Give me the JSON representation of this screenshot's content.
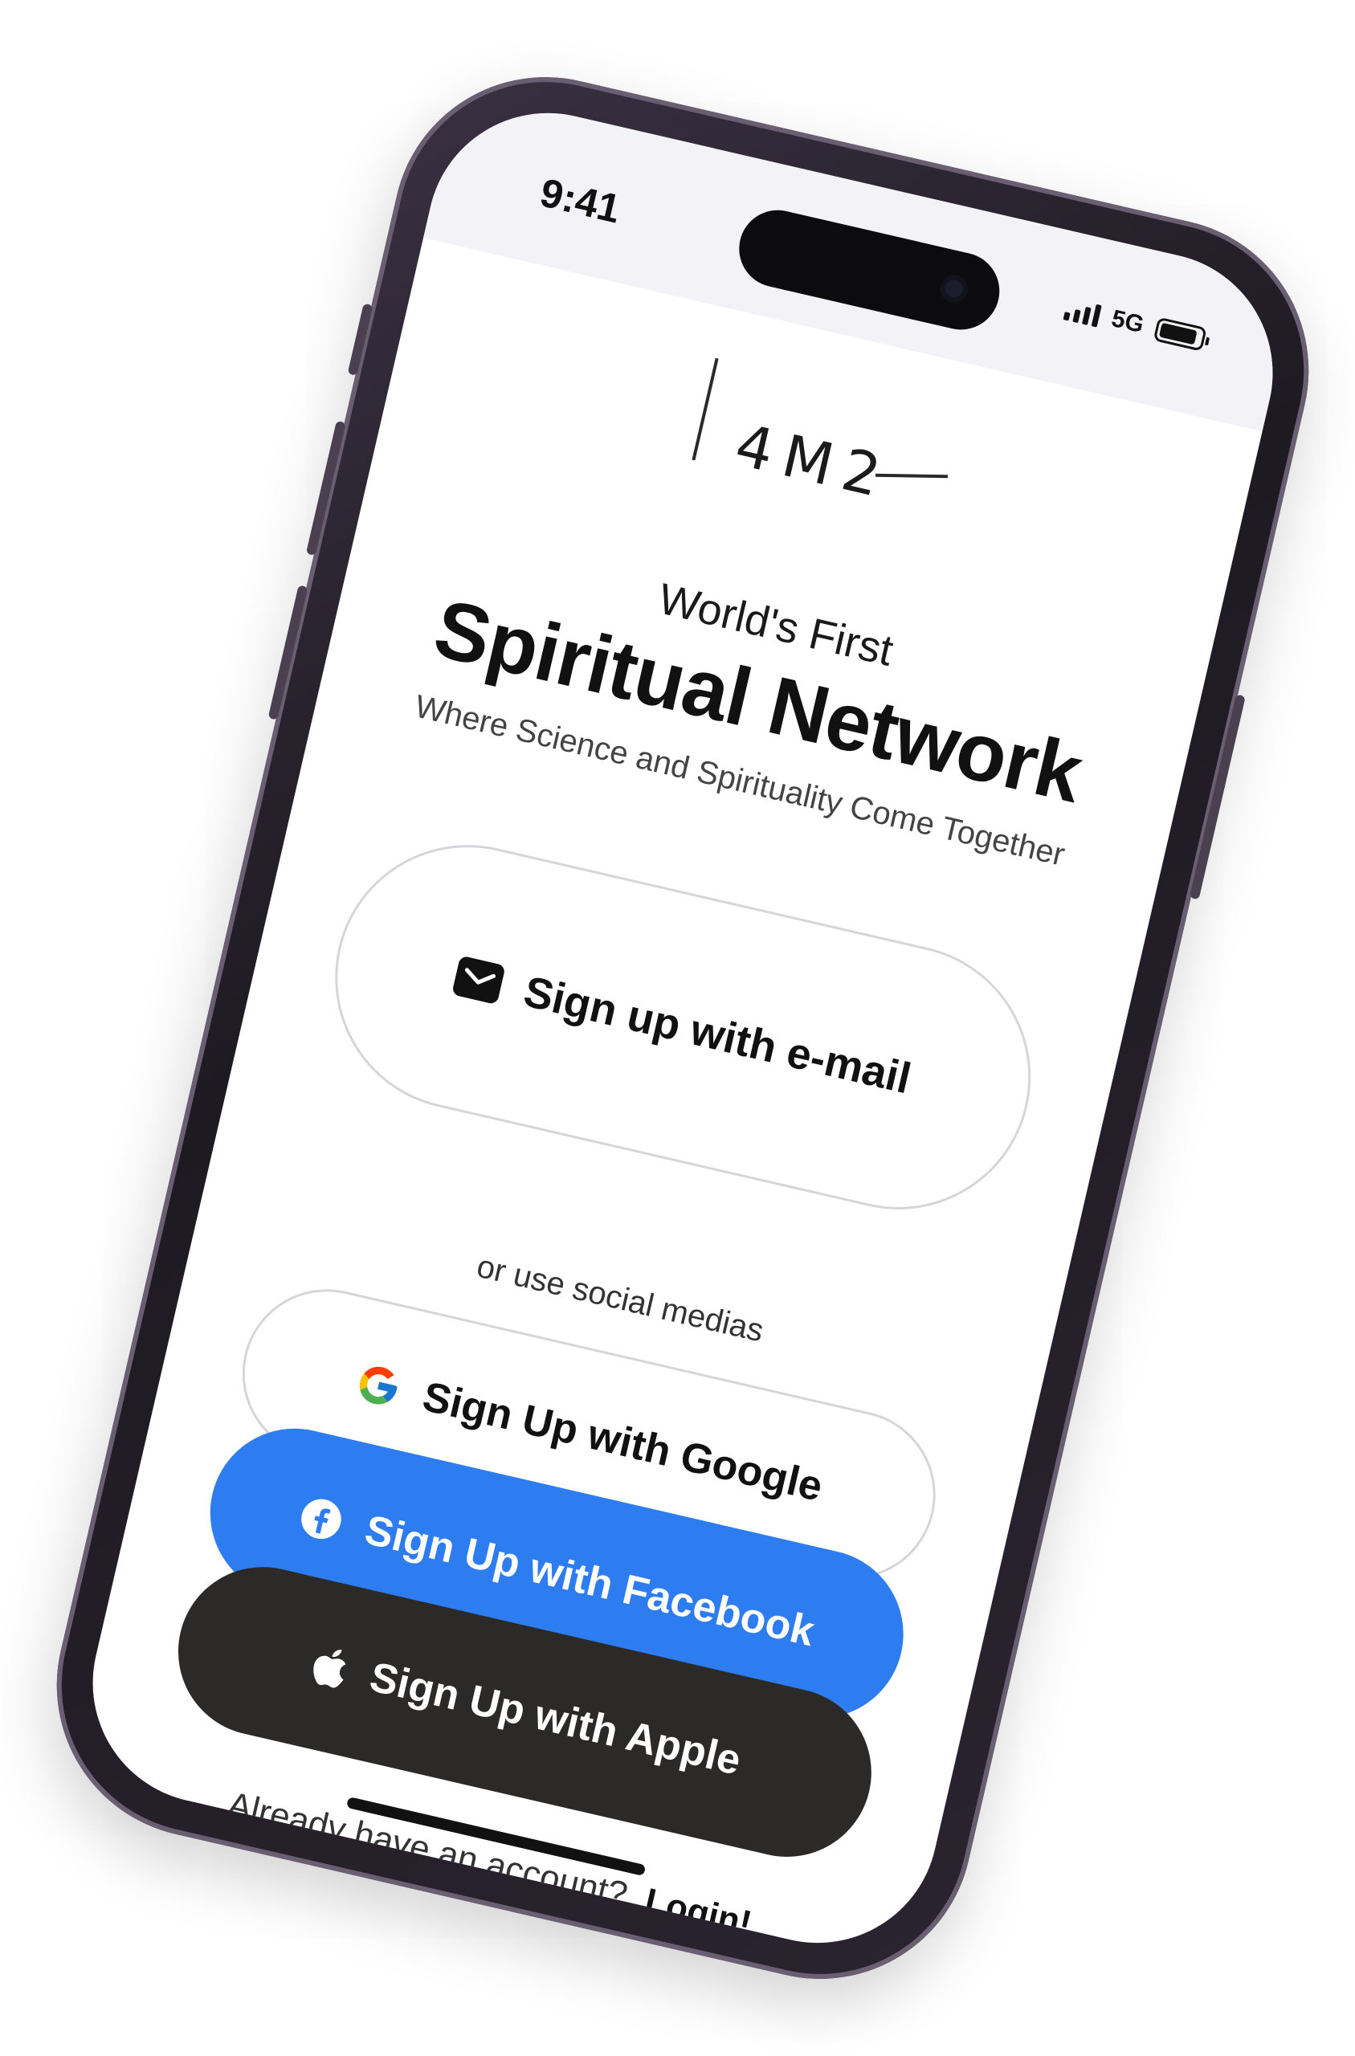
{
  "status_bar": {
    "time": "9:41",
    "network": "5G"
  },
  "brand": {
    "logo_text": "4M2"
  },
  "hero": {
    "tagline": "World's First",
    "headline": "Spiritual Network",
    "subline": "Where Science and Spirituality Come Together"
  },
  "auth": {
    "email_label": "Sign up with e-mail",
    "divider": "or use social medias",
    "google_label": "Sign Up with Google",
    "facebook_label": "Sign Up with Facebook",
    "apple_label": "Sign Up with Apple"
  },
  "footer": {
    "prompt": "Already have an account?",
    "login_label": "Login!"
  },
  "colors": {
    "facebook": "#2d7cf0",
    "apple": "#2b2a28",
    "frame": "#2a2430"
  },
  "icons": [
    "mail-icon",
    "google-icon",
    "facebook-icon",
    "apple-icon"
  ]
}
